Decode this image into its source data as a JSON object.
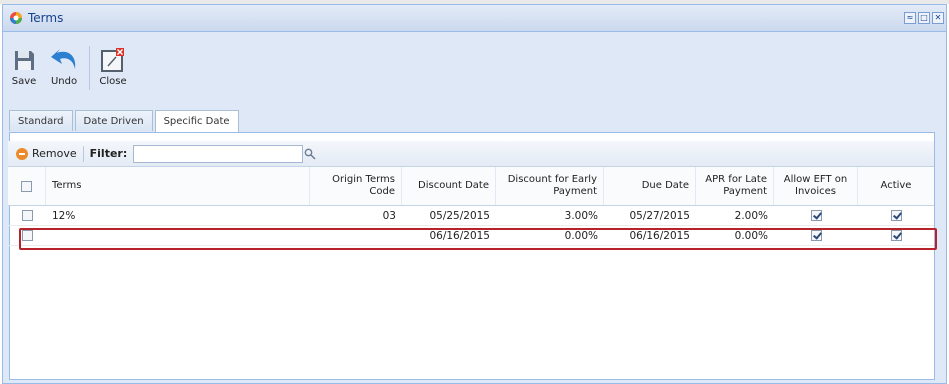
{
  "window": {
    "title": "Terms",
    "controls": [
      "≈",
      "□",
      "✕"
    ]
  },
  "toolbar": {
    "save_label": "Save",
    "undo_label": "Undo",
    "close_label": "Close"
  },
  "tabs": [
    {
      "label": "Standard"
    },
    {
      "label": "Date Driven"
    },
    {
      "label": "Specific Date"
    }
  ],
  "grid_toolbar": {
    "remove_label": "Remove",
    "filter_label": "Filter:",
    "filter_value": ""
  },
  "columns": {
    "terms": "Terms",
    "origin_terms_code": "Origin Terms Code",
    "discount_date": "Discount Date",
    "discount_for_early_payment": "Discount for Early Payment",
    "due_date": "Due Date",
    "apr_for_late_payment": "APR for Late Payment",
    "allow_eft_on_invoices": "Allow EFT on Invoices",
    "active": "Active"
  },
  "rows": [
    {
      "terms": "12%",
      "origin_terms_code": "03",
      "discount_date": "05/25/2015",
      "discount_for_early_payment": "3.00%",
      "due_date": "05/27/2015",
      "apr_for_late_payment": "2.00%",
      "allow_eft_on_invoices": true,
      "active": true
    },
    {
      "terms": "",
      "origin_terms_code": "",
      "discount_date": "06/16/2015",
      "discount_for_early_payment": "0.00%",
      "due_date": "06/16/2015",
      "apr_for_late_payment": "0.00%",
      "allow_eft_on_invoices": true,
      "active": true
    }
  ],
  "colors": {
    "accent": "#99bbe8",
    "title_text": "#15428b",
    "highlight": "#b8232b",
    "remove_icon": "#ec8a2c"
  }
}
